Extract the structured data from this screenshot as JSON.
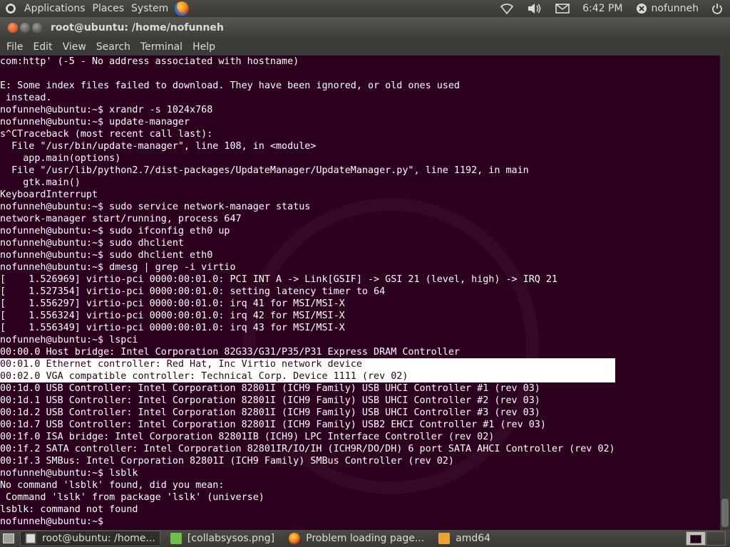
{
  "top_panel": {
    "menus": [
      "Applications",
      "Places",
      "System"
    ],
    "clock": "6:42 PM",
    "user": "nofunneh",
    "icons": [
      "ubuntu-logo-icon",
      "firefox-icon",
      "wifi-icon",
      "volume-icon",
      "mail-icon",
      "user-icon",
      "power-icon"
    ]
  },
  "window": {
    "title": "root@ubuntu: /home/nofunneh",
    "menu": [
      "File",
      "Edit",
      "View",
      "Search",
      "Terminal",
      "Help"
    ]
  },
  "terminal": {
    "lines": [
      "com:http' (-5 - No address associated with hostname)",
      "",
      "E: Some index files failed to download. They have been ignored, or old ones used",
      " instead.",
      "nofunneh@ubuntu:~$ xrandr -s 1024x768",
      "nofunneh@ubuntu:~$ update-manager",
      "s^CTraceback (most recent call last):",
      "  File \"/usr/bin/update-manager\", line 108, in <module>",
      "    app.main(options)",
      "  File \"/usr/lib/python2.7/dist-packages/UpdateManager/UpdateManager.py\", line 1192, in main",
      "    gtk.main()",
      "KeyboardInterrupt",
      "nofunneh@ubuntu:~$ sudo service network-manager status",
      "network-manager start/running, process 647",
      "nofunneh@ubuntu:~$ sudo ifconfig eth0 up",
      "nofunneh@ubuntu:~$ sudo dhclient",
      "nofunneh@ubuntu:~$ sudo dhclient eth0",
      "nofunneh@ubuntu:~$ dmesg | grep -i virtio",
      "[    1.526969] virtio-pci 0000:00:01.0: PCI INT A -> Link[GSIF] -> GSI 21 (level, high) -> IRQ 21",
      "[    1.527354] virtio-pci 0000:00:01.0: setting latency timer to 64",
      "[    1.556297] virtio-pci 0000:00:01.0: irq 41 for MSI/MSI-X",
      "[    1.556324] virtio-pci 0000:00:01.0: irq 42 for MSI/MSI-X",
      "[    1.556349] virtio-pci 0000:00:01.0: irq 43 for MSI/MSI-X",
      "nofunneh@ubuntu:~$ lspci",
      "00:00.0 Host bridge: Intel Corporation 82G33/G31/P35/P31 Express DRAM Controller",
      "00:01.0 Ethernet controller: Red Hat, Inc Virtio network device",
      "00:02.0 VGA compatible controller: Technical Corp. Device 1111 (rev 02)",
      "00:1d.0 USB Controller: Intel Corporation 82801I (ICH9 Family) USB UHCI Controller #1 (rev 03)",
      "00:1d.1 USB Controller: Intel Corporation 82801I (ICH9 Family) USB UHCI Controller #2 (rev 03)",
      "00:1d.2 USB Controller: Intel Corporation 82801I (ICH9 Family) USB UHCI Controller #3 (rev 03)",
      "00:1d.7 USB Controller: Intel Corporation 82801I (ICH9 Family) USB2 EHCI Controller #1 (rev 03)",
      "00:1f.0 ISA bridge: Intel Corporation 82801IB (ICH9) LPC Interface Controller (rev 02)",
      "00:1f.2 SATA controller: Intel Corporation 82801IR/IO/IH (ICH9R/DO/DH) 6 port SATA AHCI Controller (rev 02)",
      "00:1f.3 SMBus: Intel Corporation 82801I (ICH9 Family) SMBus Controller (rev 02)",
      "nofunneh@ubuntu:~$ lsblk",
      "No command 'lsblk' found, did you mean:",
      " Command 'lslk' from package 'lslk' (universe)",
      "lsblk: command not found",
      "nofunneh@ubuntu:~$"
    ],
    "selected_lines": [
      25,
      26
    ]
  },
  "taskbar": {
    "tasks": [
      {
        "label": "root@ubuntu: /home...",
        "icon": "terminal-icon",
        "active": true
      },
      {
        "label": "[collabsysos.png]",
        "icon": "image-viewer-icon",
        "active": false
      },
      {
        "label": "Problem loading page...",
        "icon": "firefox-icon",
        "active": false
      },
      {
        "label": "amd64",
        "icon": "folder-icon",
        "active": false
      }
    ]
  },
  "colors": {
    "terminal_bg": "#2c001e",
    "panel_bg": "#3c3b37",
    "text": "#ffffff",
    "accent": "#e0561c"
  }
}
